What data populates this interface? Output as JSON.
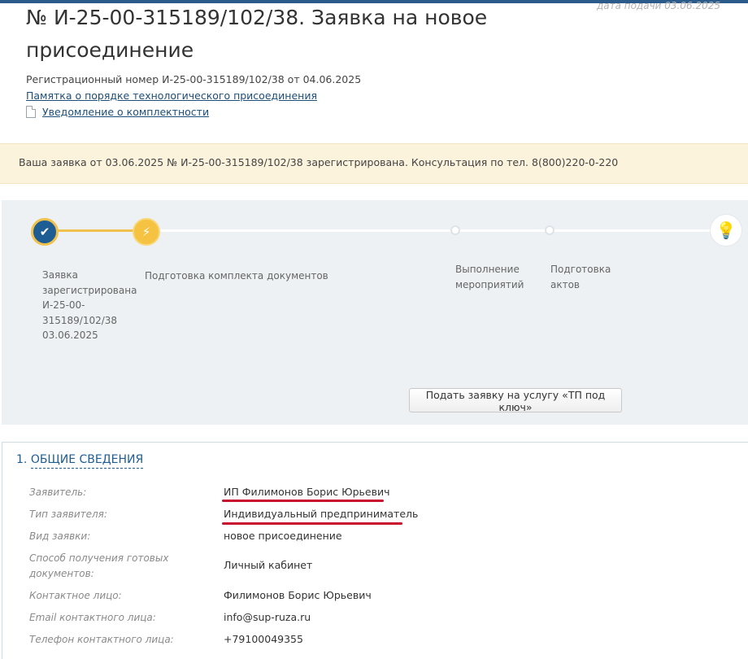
{
  "header": {
    "date_submitted": "дата подачи 03.06.2025",
    "title": "№ И-25-00-315189/102/38. Заявка на новое присоединение",
    "reg_line": "Регистрационный номер И-25-00-315189/102/38 от 04.06.2025",
    "link_memo": "Памятка о порядке технологического присоединения",
    "link_notice": "Уведомление о комплектности"
  },
  "notice": {
    "text": "Ваша заявка от 03.06.2025 № И-25-00-315189/102/38 зарегистрирована. Консультация по тел. 8(800)220-0-220"
  },
  "progress": {
    "steps": [
      {
        "label": "Заявка зарегистрирована И-25-00-315189/102/38 03.06.2025",
        "state": "done"
      },
      {
        "label": "Подготовка комплекта документов",
        "state": "current"
      },
      {
        "label": "Выполнение мероприятий",
        "state": "pending"
      },
      {
        "label": "Подготовка актов",
        "state": "pending"
      },
      {
        "label": "",
        "state": "final"
      }
    ],
    "service_button": "Подать заявку на услугу «ТП под ключ»"
  },
  "general": {
    "number": "1.",
    "title": "ОБЩИЕ СВЕДЕНИЯ",
    "fields": [
      {
        "label": "Заявитель:",
        "value": "ИП Филимонов Борис Юрьевич"
      },
      {
        "label": "Тип заявителя:",
        "value": "Индивидуальный предприниматель"
      },
      {
        "label": "Вид заявки:",
        "value": "новое присоединение"
      },
      {
        "label": "Способ получения готовых документов:",
        "value": "Личный кабинет"
      },
      {
        "label": "Контактное лицо:",
        "value": "Филимонов Борис Юрьевич"
      },
      {
        "label": "Email контактного лица:",
        "value": "info@sup-ruza.ru"
      },
      {
        "label": "Телефон контактного лица:",
        "value": "+79100049355"
      }
    ]
  },
  "colors": {
    "accent": "#1d5d94",
    "progress_done": "#f0c24b",
    "notice_bg": "#fbf3dc",
    "highlight_underline": "#c8102e"
  }
}
